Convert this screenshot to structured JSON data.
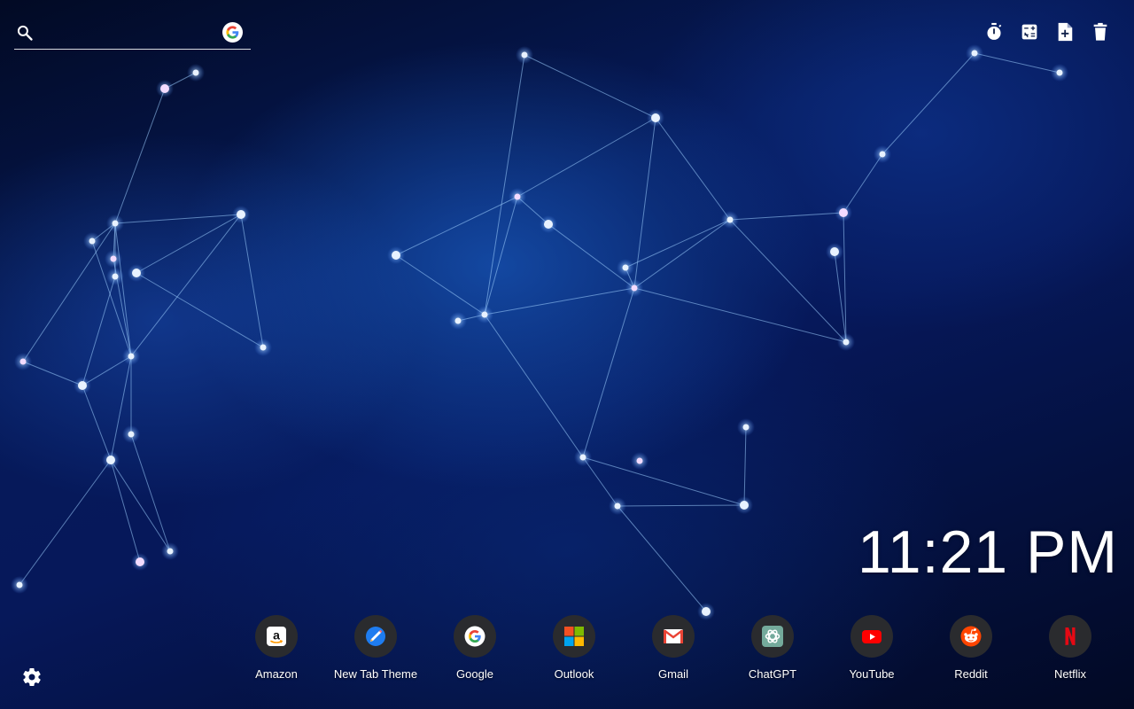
{
  "search": {
    "value": "",
    "placeholder": "",
    "engine_icon": "google-g-icon"
  },
  "toolbar": [
    {
      "name": "timer-button",
      "icon": "stopwatch-icon"
    },
    {
      "name": "calculator-button",
      "icon": "calculator-icon"
    },
    {
      "name": "new-note-button",
      "icon": "note-add-icon"
    },
    {
      "name": "delete-button",
      "icon": "trash-icon"
    }
  ],
  "clock": {
    "time": "11:21 PM"
  },
  "shortcuts": [
    {
      "label": "Amazon",
      "icon": "amazon-icon"
    },
    {
      "label": "New Tab Theme",
      "icon": "new-tab-theme-icon"
    },
    {
      "label": "Google",
      "icon": "google-icon"
    },
    {
      "label": "Outlook",
      "icon": "microsoft-icon"
    },
    {
      "label": "Gmail",
      "icon": "gmail-icon"
    },
    {
      "label": "ChatGPT",
      "icon": "chatgpt-icon"
    },
    {
      "label": "YouTube",
      "icon": "youtube-icon"
    },
    {
      "label": "Reddit",
      "icon": "reddit-icon"
    },
    {
      "label": "Netflix",
      "icon": "netflix-icon"
    }
  ],
  "settings": {
    "icon": "gear-icon"
  },
  "colors": {
    "tile_background": "#2a2b2e",
    "amazon_orange": "#ff9900",
    "google_blue": "#4285f4",
    "google_red": "#ea4335",
    "google_yellow": "#fbbc05",
    "google_green": "#34a853",
    "youtube_red": "#ff0000",
    "reddit_orange": "#ff4500",
    "netflix_red": "#e50914",
    "chatgpt_green": "#74aa9c"
  }
}
